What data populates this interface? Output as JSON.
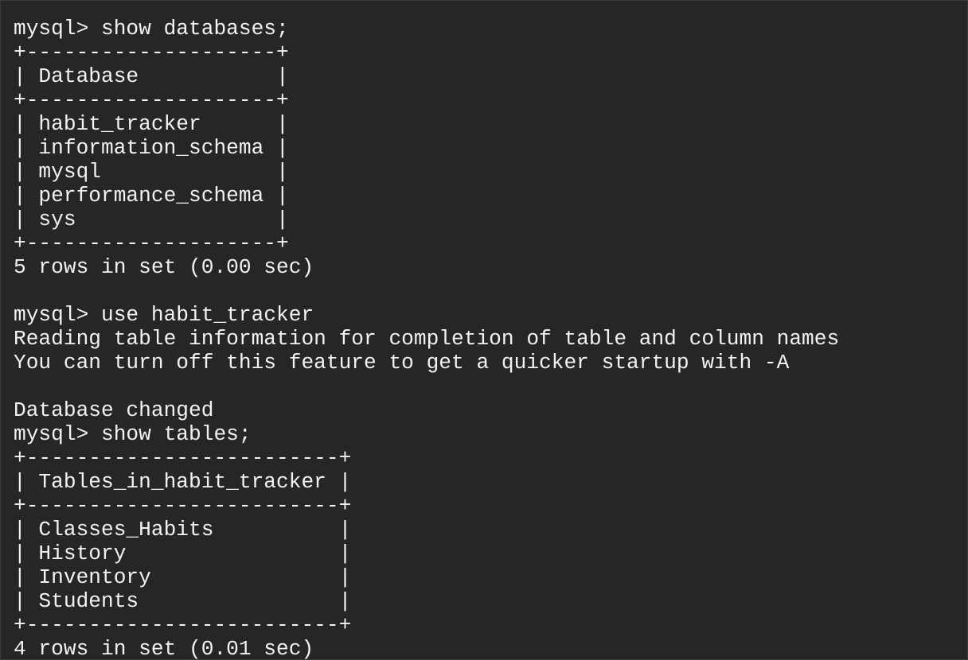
{
  "terminal": {
    "lines": [
      "mysql> show databases;",
      "+--------------------+",
      "| Database           |",
      "+--------------------+",
      "| habit_tracker      |",
      "| information_schema |",
      "| mysql              |",
      "| performance_schema |",
      "| sys                |",
      "+--------------------+",
      "5 rows in set (0.00 sec)",
      "",
      "mysql> use habit_tracker",
      "Reading table information for completion of table and column names",
      "You can turn off this feature to get a quicker startup with -A",
      "",
      "Database changed",
      "mysql> show tables;",
      "+-------------------------+",
      "| Tables_in_habit_tracker |",
      "+-------------------------+",
      "| Classes_Habits          |",
      "| History                 |",
      "| Inventory               |",
      "| Students                |",
      "+-------------------------+",
      "4 rows in set (0.01 sec)"
    ]
  }
}
